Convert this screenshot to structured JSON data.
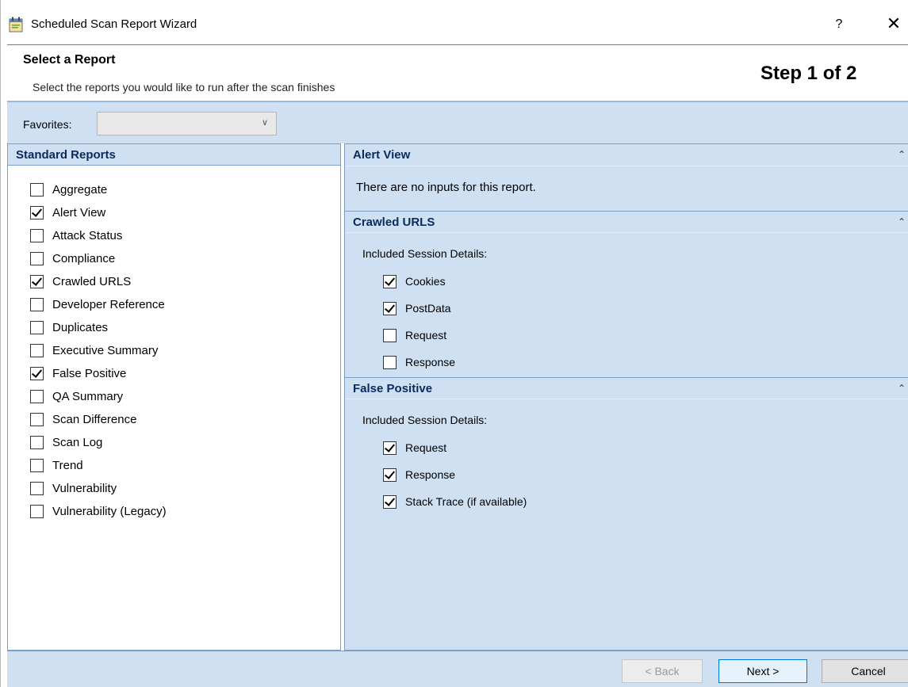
{
  "window": {
    "title": "Scheduled Scan Report Wizard",
    "help_label": "?",
    "close_label": "✕"
  },
  "header": {
    "title": "Select a Report",
    "subtitle": "Select the reports you would like to run after the scan finishes",
    "step": "Step 1 of 2"
  },
  "favorites": {
    "label": "Favorites:",
    "value": ""
  },
  "standard_reports": {
    "title": "Standard Reports",
    "items": [
      {
        "label": "Aggregate",
        "checked": false
      },
      {
        "label": "Alert View",
        "checked": true
      },
      {
        "label": "Attack Status",
        "checked": false
      },
      {
        "label": "Compliance",
        "checked": false
      },
      {
        "label": "Crawled URLS",
        "checked": true
      },
      {
        "label": "Developer Reference",
        "checked": false
      },
      {
        "label": "Duplicates",
        "checked": false
      },
      {
        "label": "Executive Summary",
        "checked": false
      },
      {
        "label": "False Positive",
        "checked": true
      },
      {
        "label": "QA Summary",
        "checked": false
      },
      {
        "label": "Scan Difference",
        "checked": false
      },
      {
        "label": "Scan Log",
        "checked": false
      },
      {
        "label": "Trend",
        "checked": false
      },
      {
        "label": "Vulnerability",
        "checked": false
      },
      {
        "label": "Vulnerability (Legacy)",
        "checked": false
      }
    ]
  },
  "sections": {
    "alert_view": {
      "title": "Alert View",
      "message": "There are no inputs for this report."
    },
    "crawled_urls": {
      "title": "Crawled URLS",
      "details_label": "Included Session Details:",
      "items": [
        {
          "label": "Cookies",
          "checked": true
        },
        {
          "label": "PostData",
          "checked": true
        },
        {
          "label": "Request",
          "checked": false
        },
        {
          "label": "Response",
          "checked": false
        }
      ]
    },
    "false_positive": {
      "title": "False Positive",
      "details_label": "Included Session Details:",
      "items": [
        {
          "label": "Request",
          "checked": true
        },
        {
          "label": "Response",
          "checked": true
        },
        {
          "label": "Stack Trace (if available)",
          "checked": true
        }
      ]
    }
  },
  "footer": {
    "back_label": "< Back",
    "next_label": "Next >",
    "cancel_label": "Cancel"
  },
  "colors": {
    "panel_bg": "#cfe0f3",
    "panel_border": "#7d9ec6",
    "header_text": "#0a2a5e"
  },
  "icons": {
    "app": "scheduled-report-icon",
    "collapse": "double-chevron-up-icon",
    "dropdown": "chevron-down-icon"
  }
}
